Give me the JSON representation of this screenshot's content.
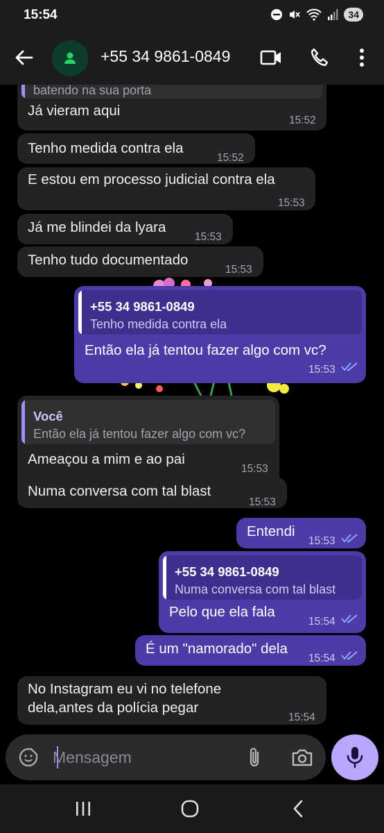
{
  "status_bar": {
    "time": "15:54",
    "battery": "34"
  },
  "header": {
    "contact": "+55 34 9861-0849"
  },
  "messages": {
    "m0": {
      "quote_text": "batendo na sua porta",
      "text": "Já vieram aqui",
      "time": "15:52"
    },
    "m1": {
      "text": "Tenho medida contra ela",
      "time": "15:52"
    },
    "m2": {
      "text": "E estou em processo judicial contra ela",
      "time": "15:53"
    },
    "m3": {
      "text": "Já me blindei da lyara",
      "time": "15:53"
    },
    "m4": {
      "text": "Tenho tudo documentado",
      "time": "15:53"
    },
    "m5": {
      "quote_name": "+55 34 9861-0849",
      "quote_text": "Tenho medida contra ela",
      "text": "Então ela já tentou fazer algo com vc?",
      "time": "15:53"
    },
    "m6": {
      "quote_name": "Você",
      "quote_text": "Então ela já tentou fazer algo com vc?",
      "text": "Ameaçou a mim e ao pai",
      "time": "15:53"
    },
    "m7": {
      "text": "Numa conversa com tal blast",
      "time": "15:53"
    },
    "m8": {
      "text": "Entendi",
      "time": "15:53"
    },
    "m9": {
      "quote_name": "+55 34 9861-0849",
      "quote_text": "Numa conversa com tal blast",
      "text": "Pelo que ela fala",
      "time": "15:54"
    },
    "m10": {
      "text": "É um \"namorado\" dela",
      "time": "15:54"
    },
    "m11": {
      "text_line1": "No Instagram eu vi no telefone",
      "text_line2": "dela,antes da polícia pegar",
      "time": "15:54"
    }
  },
  "composer": {
    "placeholder": "Mensagem"
  },
  "colors": {
    "incoming_bubble": "#232325",
    "outgoing_bubble": "#4f3ba8",
    "read_ticks": "#8ab4ff",
    "mic_button": "#b9a6ff",
    "avatar_icon": "#25d366"
  },
  "icons": {
    "status": [
      "do-not-disturb-icon",
      "mute-icon",
      "wifi-icon",
      "signal-icon"
    ],
    "header": [
      "back-arrow-icon",
      "contact-avatar-icon",
      "video-call-icon",
      "voice-call-icon",
      "more-options-icon"
    ],
    "composer": [
      "sticker-icon",
      "attach-icon",
      "camera-icon",
      "mic-icon"
    ],
    "navigation": [
      "recents-icon",
      "home-icon",
      "nav-back-icon"
    ]
  }
}
